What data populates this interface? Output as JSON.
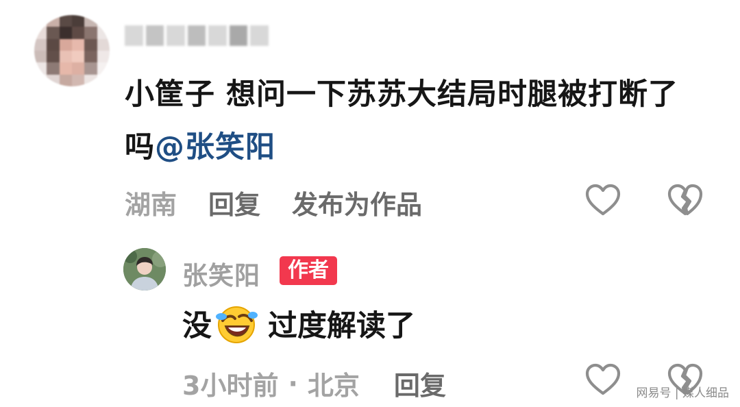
{
  "comment": {
    "text": "小筐子 想问一下苏苏大结局时腿被打断了吗",
    "mention": "@张笑阳",
    "location": "湖南",
    "reply_label": "回复",
    "publish_label": "发布为作品",
    "like_icon": "heart-outline-icon",
    "dislike_icon": "broken-heart-icon"
  },
  "reply": {
    "username": "张笑阳",
    "badge": "作者",
    "text_before": "没",
    "emoji": "rolling-laughing-emoji",
    "text_after": "过度解读了",
    "time": "3小时前",
    "separator": "·",
    "location": "北京",
    "reply_label": "回复"
  },
  "watermark": "网易号 | 媒人细品",
  "colors": {
    "mention": "#1f4e84",
    "badge": "#f2384e",
    "muted": "#a3a3a3",
    "action": "#6a6a6a",
    "text": "#161616"
  }
}
